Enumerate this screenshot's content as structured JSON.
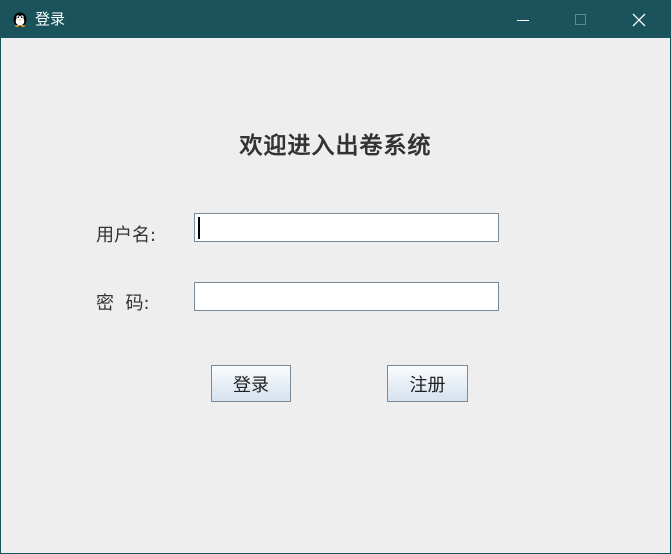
{
  "window": {
    "title": "登录",
    "icon": "penguin-icon",
    "controls": [
      "minimize-icon",
      "maximize-icon",
      "close-icon"
    ],
    "titlebar_color": "#1a535c",
    "background_color": "#eeeeee"
  },
  "form": {
    "heading": "欢迎进入出卷系统",
    "username_label": "用户名:",
    "username_value": "",
    "password_label": "密  码:",
    "password_value": "",
    "login_button": "登录",
    "register_button": "注册"
  }
}
